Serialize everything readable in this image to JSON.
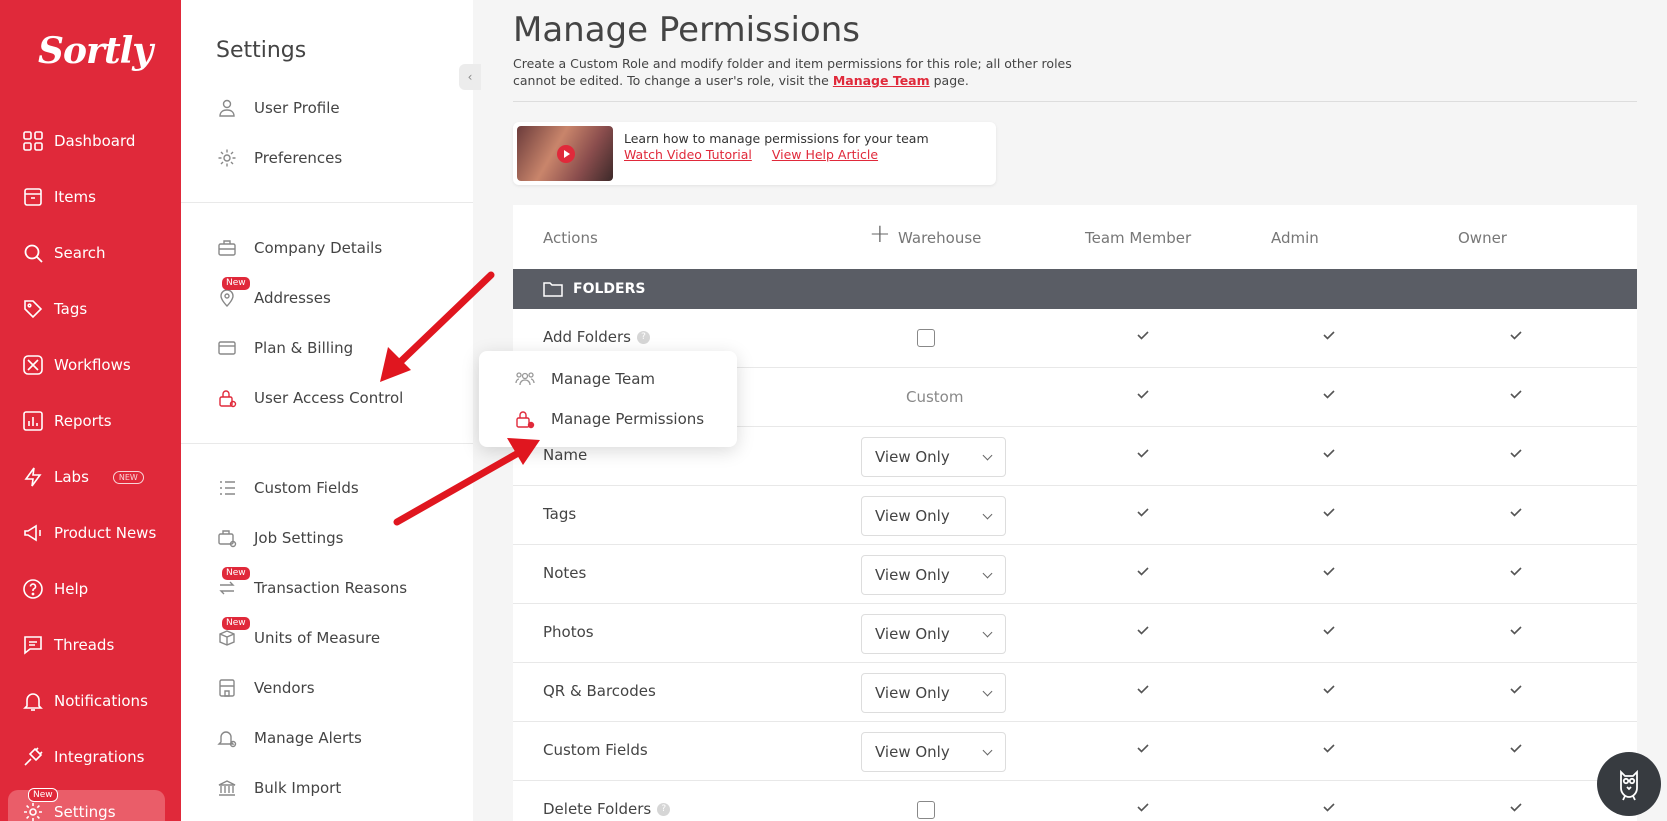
{
  "brand": {
    "logo": "Sortly",
    "accent": "#e0293a"
  },
  "leftnav": {
    "items": [
      {
        "label": "Dashboard",
        "icon": "grid-icon"
      },
      {
        "label": "Items",
        "icon": "box-icon"
      },
      {
        "label": "Search",
        "icon": "search-icon"
      },
      {
        "label": "Tags",
        "icon": "tag-icon"
      },
      {
        "label": "Workflows",
        "icon": "workflow-icon"
      },
      {
        "label": "Reports",
        "icon": "chart-icon"
      },
      {
        "label": "Labs",
        "icon": "bolt-icon",
        "pill": "NEW"
      },
      {
        "label": "Product News",
        "icon": "megaphone-icon"
      },
      {
        "label": "Help",
        "icon": "help-icon"
      },
      {
        "label": "Threads",
        "icon": "chat-icon"
      },
      {
        "label": "Notifications",
        "icon": "bell-icon"
      },
      {
        "label": "Integrations",
        "icon": "plug-icon"
      },
      {
        "label": "Settings",
        "icon": "gear-icon",
        "badge": "New"
      }
    ]
  },
  "settings": {
    "title": "Settings",
    "items": [
      {
        "label": "User Profile",
        "icon": "user-icon"
      },
      {
        "label": "Preferences",
        "icon": "gear-icon"
      },
      {
        "label": "Company Details",
        "icon": "briefcase-icon"
      },
      {
        "label": "Addresses",
        "icon": "pin-icon",
        "badge": "New"
      },
      {
        "label": "Plan & Billing",
        "icon": "card-icon"
      },
      {
        "label": "User Access Control",
        "icon": "lock-icon"
      },
      {
        "label": "Custom Fields",
        "icon": "list-icon"
      },
      {
        "label": "Job Settings",
        "icon": "job-icon"
      },
      {
        "label": "Transaction Reasons",
        "icon": "swap-icon",
        "badge": "New"
      },
      {
        "label": "Units of Measure",
        "icon": "measure-icon",
        "badge": "New"
      },
      {
        "label": "Vendors",
        "icon": "store-icon"
      },
      {
        "label": "Manage Alerts",
        "icon": "bell-gear-icon"
      },
      {
        "label": "Bulk Import",
        "icon": "bank-icon"
      }
    ]
  },
  "popup": {
    "items": [
      {
        "label": "Manage Team",
        "icon": "team-icon"
      },
      {
        "label": "Manage Permissions",
        "icon": "lock-gear-icon"
      }
    ]
  },
  "main": {
    "title": "Manage Permissions",
    "desc_part1": "Create a Custom Role and modify folder and item permissions for this role; all other roles cannot be edited. To change a user's role, visit the ",
    "desc_link": "Manage Team",
    "desc_part2": " page.",
    "video": {
      "text": "Learn how to manage permissions for your team",
      "link1": "Watch Video Tutorial",
      "link2": "View Help Article"
    },
    "table": {
      "headers": [
        "Actions",
        "Warehouse",
        "Team Member",
        "Admin",
        "Owner"
      ],
      "section": "FOLDERS",
      "rows": [
        {
          "label": "Add Folders",
          "help": true,
          "warehouse_type": "checkbox"
        },
        {
          "label": "",
          "warehouse_type": "text",
          "warehouse_value": "Custom"
        },
        {
          "label": "Name",
          "warehouse_type": "select",
          "warehouse_value": "View Only"
        },
        {
          "label": "Tags",
          "warehouse_type": "select",
          "warehouse_value": "View Only"
        },
        {
          "label": "Notes",
          "warehouse_type": "select",
          "warehouse_value": "View Only"
        },
        {
          "label": "Photos",
          "warehouse_type": "select",
          "warehouse_value": "View Only"
        },
        {
          "label": "QR & Barcodes",
          "warehouse_type": "select",
          "warehouse_value": "View Only"
        },
        {
          "label": "Custom Fields",
          "warehouse_type": "select",
          "warehouse_value": "View Only"
        },
        {
          "label": "Delete Folders",
          "help": true,
          "warehouse_type": "checkbox"
        }
      ]
    }
  }
}
